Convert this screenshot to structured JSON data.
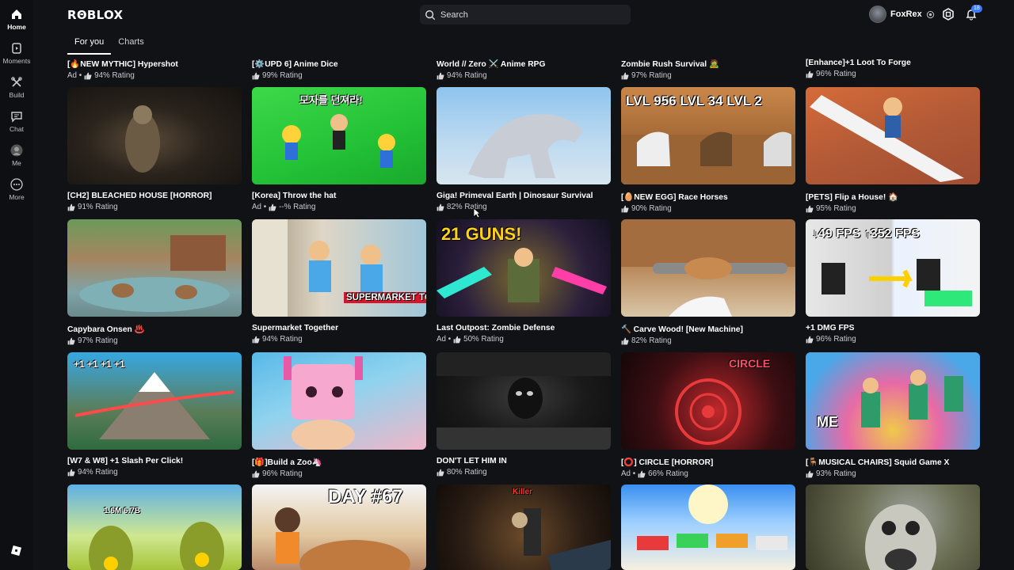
{
  "app": {
    "logo": "RΘBLOX"
  },
  "nav": [
    {
      "label": "Home",
      "icon": "home-icon",
      "active": true
    },
    {
      "label": "Moments",
      "icon": "moments-icon",
      "active": false
    },
    {
      "label": "Build",
      "icon": "build-icon",
      "active": false
    },
    {
      "label": "Chat",
      "icon": "chat-icon",
      "active": false
    },
    {
      "label": "Me",
      "icon": "me-avatar-icon",
      "active": false
    },
    {
      "label": "More",
      "icon": "more-icon",
      "active": false
    }
  ],
  "search": {
    "placeholder": "Search"
  },
  "user": {
    "name": "FoxRex",
    "notifications": "18"
  },
  "tabs": [
    {
      "label": "For you",
      "active": true
    },
    {
      "label": "Charts",
      "active": false
    }
  ],
  "top_row": [
    {
      "title": "[🔥NEW MYTHIC] Hypershot",
      "ad": "Ad •",
      "rating": "94% Rating"
    },
    {
      "title": "[⚙️UPD 6] Anime Dice",
      "ad": "",
      "rating": "99% Rating"
    },
    {
      "title": "World // Zero ⚔️ Anime RPG",
      "ad": "",
      "rating": "94% Rating"
    },
    {
      "title": "Zombie Rush Survival 🧟",
      "ad": "",
      "rating": "97% Rating"
    },
    {
      "title": "[Enhance]+1 Loot To Forge",
      "ad": "",
      "rating": "96% Rating"
    }
  ],
  "rows": [
    [
      {
        "title": "[CH2] BLEACHED HOUSE [HORROR]",
        "ad": "",
        "rating": "91% Rating",
        "overlay": ""
      },
      {
        "title": "[Korea] Throw the hat",
        "ad": "Ad •",
        "rating": "--% Rating",
        "overlay": "모자를 던져라!"
      },
      {
        "title": "Giga! Primeval Earth | Dinosaur Survival",
        "ad": "",
        "rating": "82% Rating",
        "overlay": ""
      },
      {
        "title": "[🥚NEW EGG] Race Horses",
        "ad": "",
        "rating": "90% Rating",
        "overlay": "LVL 956   LVL 34   LVL 2"
      },
      {
        "title": "[PETS] Flip a House! 🏠",
        "ad": "",
        "rating": "95% Rating",
        "overlay": ""
      }
    ],
    [
      {
        "title": "Capybara Onsen ♨️",
        "ad": "",
        "rating": "97% Rating",
        "overlay": ""
      },
      {
        "title": "Supermarket Together",
        "ad": "",
        "rating": "94% Rating",
        "overlay": "SUPERMARKET TOGETHER"
      },
      {
        "title": "Last Outpost: Zombie Defense",
        "ad": "Ad •",
        "rating": "50% Rating",
        "overlay": "21 GUNS!"
      },
      {
        "title": "🔨 Carve Wood! [New Machine]",
        "ad": "",
        "rating": "82% Rating",
        "overlay": ""
      },
      {
        "title": "+1 DMG FPS",
        "ad": "",
        "rating": "96% Rating",
        "overlay": "↓49 FPS    ↑352 FPS"
      }
    ],
    [
      {
        "title": "[W7 & W8] +1 Slash Per Click!",
        "ad": "",
        "rating": "94% Rating",
        "overlay": "+1  +1  +1  +1"
      },
      {
        "title": "[🎁]Build a Zoo🦄",
        "ad": "",
        "rating": "96% Rating",
        "overlay": ""
      },
      {
        "title": "DON'T LET HIM IN",
        "ad": "",
        "rating": "80% Rating",
        "overlay": ""
      },
      {
        "title": "[⭕] CIRCLE [HORROR]",
        "ad": "Ad •",
        "rating": "66% Rating",
        "overlay": "CIRCLE"
      },
      {
        "title": "[🪑MUSICAL CHAIRS] Squid Game X",
        "ad": "",
        "rating": "93% Rating",
        "overlay": "ME"
      }
    ],
    [
      {
        "title": "",
        "ad": "",
        "rating": "",
        "overlay": "1.6M   6.7B"
      },
      {
        "title": "",
        "ad": "",
        "rating": "",
        "overlay": "DAY #67"
      },
      {
        "title": "",
        "ad": "",
        "rating": "",
        "overlay": "Killer"
      },
      {
        "title": "",
        "ad": "",
        "rating": "",
        "overlay": ""
      },
      {
        "title": "",
        "ad": "",
        "rating": "",
        "overlay": ""
      }
    ]
  ],
  "colors": {
    "background": "#111216",
    "accent": "#3c7bff"
  }
}
